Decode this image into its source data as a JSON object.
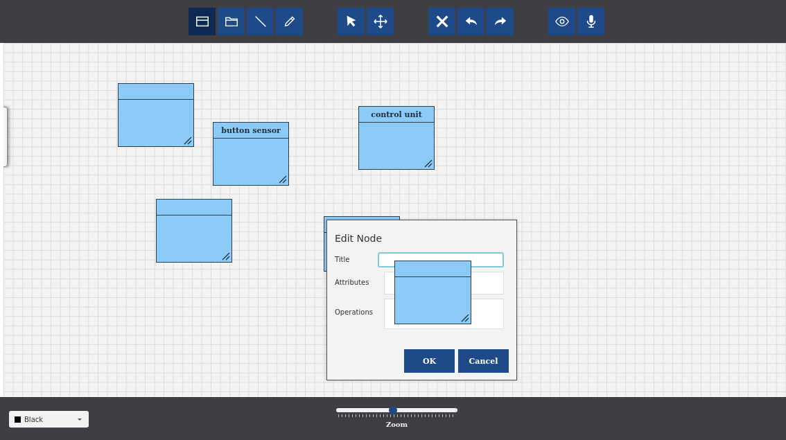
{
  "toolbar": {
    "groups": [
      {
        "buttons": [
          {
            "kind": "frame",
            "selected": true
          },
          {
            "kind": "folder",
            "selected": false
          },
          {
            "kind": "line",
            "selected": false
          },
          {
            "kind": "pencil",
            "selected": false
          }
        ]
      },
      {
        "buttons": [
          {
            "kind": "pointer",
            "selected": false
          },
          {
            "kind": "move",
            "selected": false
          }
        ]
      },
      {
        "buttons": [
          {
            "kind": "delete",
            "selected": false
          },
          {
            "kind": "undo",
            "selected": false
          },
          {
            "kind": "redo",
            "selected": false
          }
        ]
      },
      {
        "buttons": [
          {
            "kind": "view",
            "selected": false
          },
          {
            "kind": "mic",
            "selected": false
          }
        ]
      }
    ]
  },
  "canvas": {
    "nodes": [
      {
        "kind": "class"
      },
      {
        "kind": "class",
        "title": "button sensor"
      },
      {
        "kind": "class",
        "title": "control unit"
      },
      {
        "kind": "class"
      },
      {
        "kind": "class"
      }
    ]
  },
  "dialog": {
    "title": "Edit Node",
    "fields": [
      {
        "label": "Title",
        "focused": true
      },
      {
        "label": "Attributes",
        "focused": false
      },
      {
        "label": "Operations",
        "focused": false
      }
    ],
    "buttons": [
      "OK",
      "Cancel"
    ]
  },
  "floating_node": {
    "kind": "class"
  },
  "bottom_bar": {
    "color_select": {
      "value": "Black"
    },
    "zoom": {
      "level": 0.47,
      "label": "Zoom"
    }
  }
}
